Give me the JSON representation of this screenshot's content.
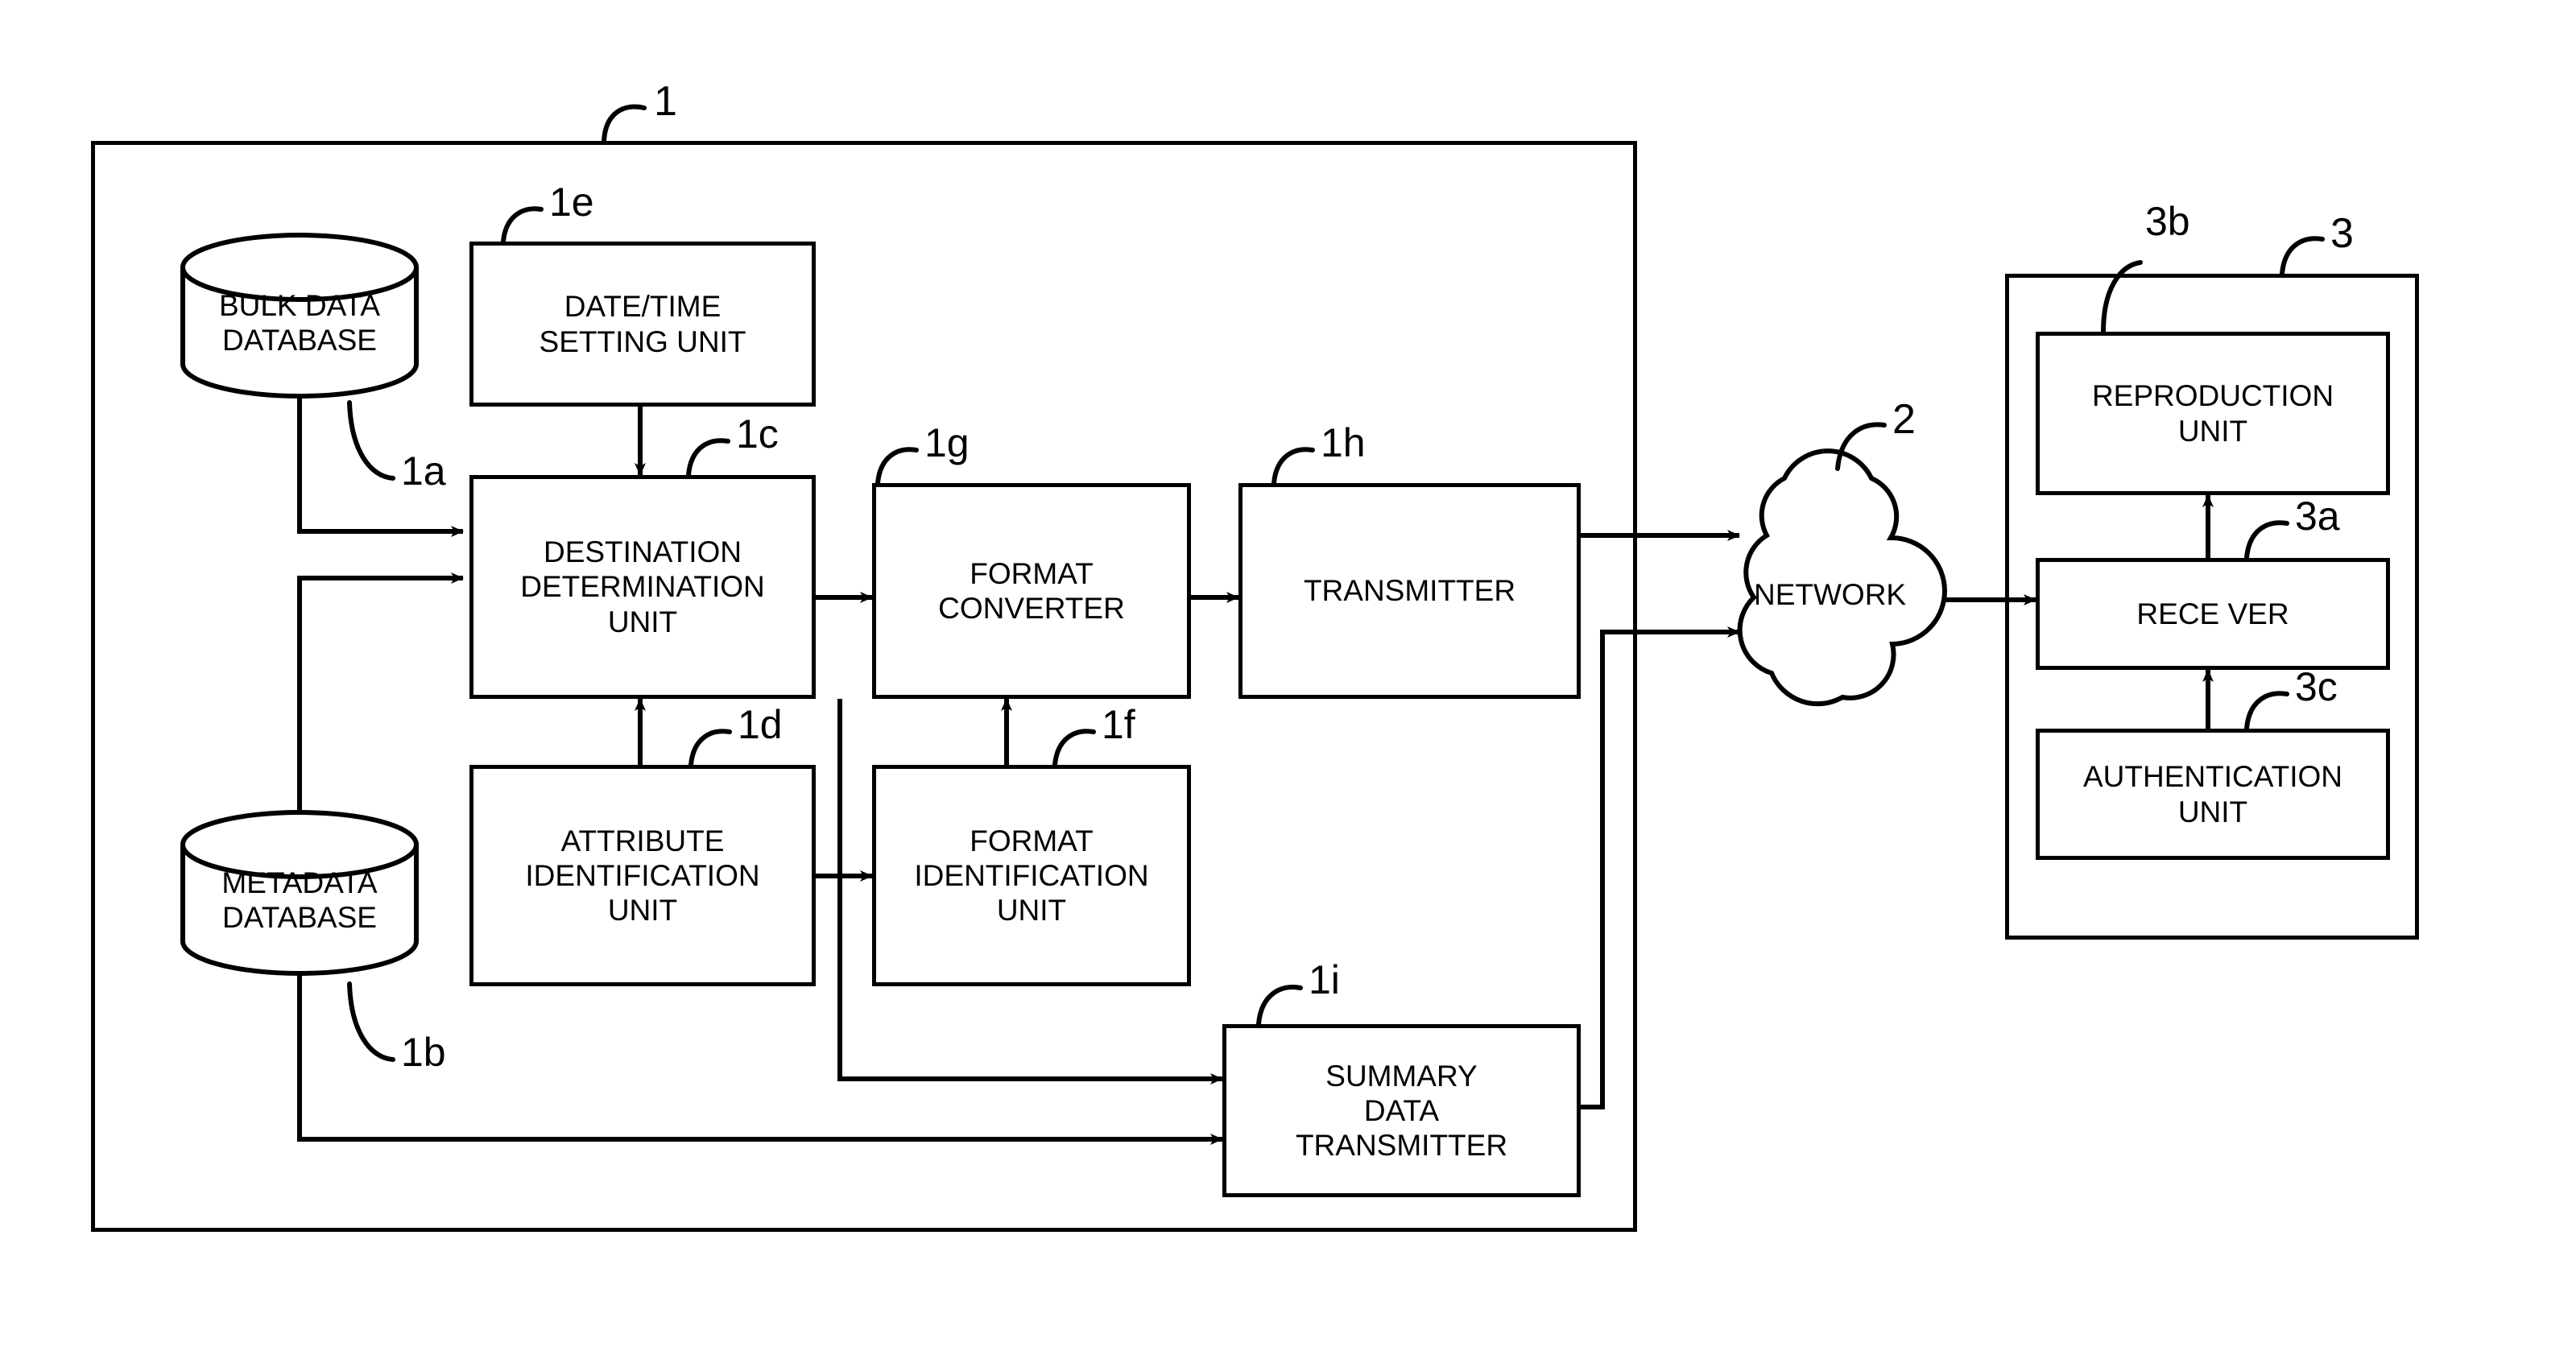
{
  "figure": {
    "title": "Data distribution system block diagram",
    "line_color": "#000000",
    "background": "#ffffff"
  },
  "system_box": {
    "ref": "1"
  },
  "terminal_box": {
    "ref": "3"
  },
  "databases": [
    {
      "id": "bulk-data-database",
      "ref": "1a",
      "line1": "BULK DATA",
      "line2": "DATABASE"
    },
    {
      "id": "metadata-database",
      "ref": "1b",
      "line1": "METADATA",
      "line2": "DATABASE"
    }
  ],
  "blocks": [
    {
      "id": "date-time-setting-unit",
      "ref": "1e",
      "lines": [
        "DATE/TIME",
        "SETTING UNIT"
      ]
    },
    {
      "id": "destination-determination-unit",
      "ref": "1c",
      "lines": [
        "DESTINATION",
        "DETERMINATION",
        "UNIT"
      ]
    },
    {
      "id": "format-converter",
      "ref": "1g",
      "lines": [
        "FORMAT",
        "CONVERTER"
      ]
    },
    {
      "id": "transmitter",
      "ref": "1h",
      "lines": [
        "TRANSMITTER"
      ]
    },
    {
      "id": "attribute-identification-unit",
      "ref": "1d",
      "lines": [
        "ATTRIBUTE",
        "IDENTIFICATION",
        "UNIT"
      ]
    },
    {
      "id": "format-identification-unit",
      "ref": "1f",
      "lines": [
        "FORMAT",
        "IDENTIFICATION",
        "UNIT"
      ]
    },
    {
      "id": "summary-data-transmitter",
      "ref": "1i",
      "lines": [
        "SUMMARY",
        "DATA",
        "TRANSMITTER"
      ]
    },
    {
      "id": "reproduction-unit",
      "ref": "3b",
      "lines": [
        "REPRODUCTION",
        "UNIT"
      ]
    },
    {
      "id": "receiver",
      "ref": "3a",
      "lines": [
        "RECE VER"
      ]
    },
    {
      "id": "authentication-unit",
      "ref": "3c",
      "lines": [
        "AUTHENTICATION",
        "UNIT"
      ]
    }
  ],
  "network": {
    "id": "network-cloud",
    "ref": "2",
    "label": "NETWORK"
  }
}
